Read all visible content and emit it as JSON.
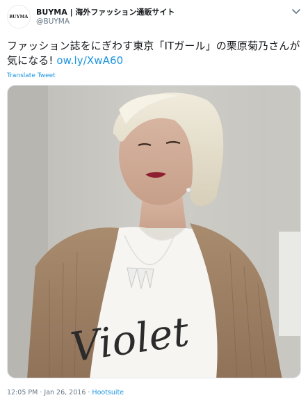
{
  "account": {
    "display_name": "BUYMA | 海外ファッション通販サイト",
    "handle": "@BUYMA",
    "avatar_text": "BUYMA"
  },
  "tweet": {
    "text": "ファッション誌をにぎわす東京「ITガール」の栗原菊乃さんが気になる! ",
    "link": "ow.ly/XwA60",
    "translate_label": "Translate Tweet",
    "image_shirt_text": "Violet"
  },
  "meta": {
    "time": "12:05 PM",
    "sep1": " · ",
    "date": "Jan 26, 2016",
    "sep2": " · ",
    "source": "Hootsuite"
  }
}
